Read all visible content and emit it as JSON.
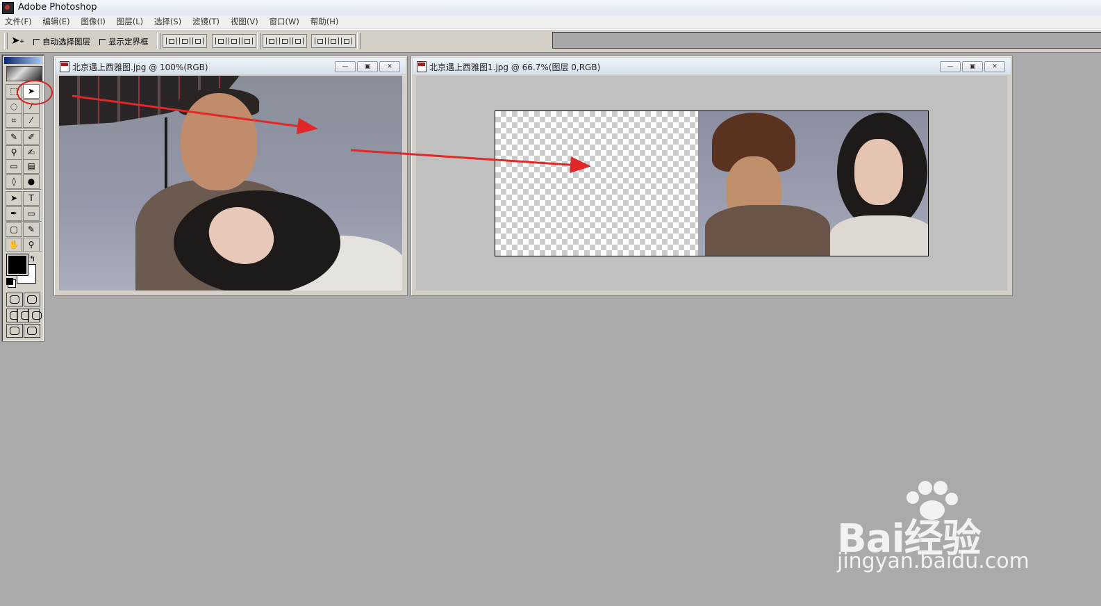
{
  "app": {
    "title": "Adobe Photoshop"
  },
  "menu": [
    "文件(F)",
    "编辑(E)",
    "图像(I)",
    "图层(L)",
    "选择(S)",
    "滤镜(T)",
    "视图(V)",
    "窗口(W)",
    "帮助(H)"
  ],
  "options": {
    "auto_select_label": "自动选择图层",
    "show_bounds_label": "显示定界框"
  },
  "doc1": {
    "title": "北京遇上西雅图.jpg @ 100%(RGB)"
  },
  "doc2": {
    "title": "北京遇上西雅图1.jpg @ 66.7%(图层 0,RGB)"
  },
  "window_buttons": {
    "minimize": "—",
    "maximize": "▣",
    "close": "✕"
  },
  "toolbox": {
    "tools": [
      "marquee-icon",
      "move-icon",
      "lasso-icon",
      "magic-wand-icon",
      "crop-icon",
      "slice-icon",
      "healing-brush-icon",
      "brush-icon",
      "clone-stamp-icon",
      "history-brush-icon",
      "eraser-icon",
      "gradient-icon",
      "blur-icon",
      "dodge-icon",
      "path-select-icon",
      "type-icon",
      "pen-icon",
      "rectangle-icon",
      "notes-icon",
      "eyedropper-icon",
      "hand-icon",
      "zoom-icon"
    ],
    "glyphs": [
      "⬚",
      "➤",
      "◌",
      "⁄",
      "⌗",
      "⁄",
      "✎",
      "✐",
      "⚲",
      "✍",
      "▭",
      "▤",
      "◊",
      "●",
      "➤",
      "T",
      "✒",
      "▭",
      "▢",
      "✎",
      "✋",
      "⚲"
    ],
    "foreground_color": "#000000",
    "background_color": "#ffffff"
  },
  "watermark": {
    "brand": "Bai经验",
    "url": "jingyan.baidu.com"
  },
  "annotation_color": "#e02828"
}
